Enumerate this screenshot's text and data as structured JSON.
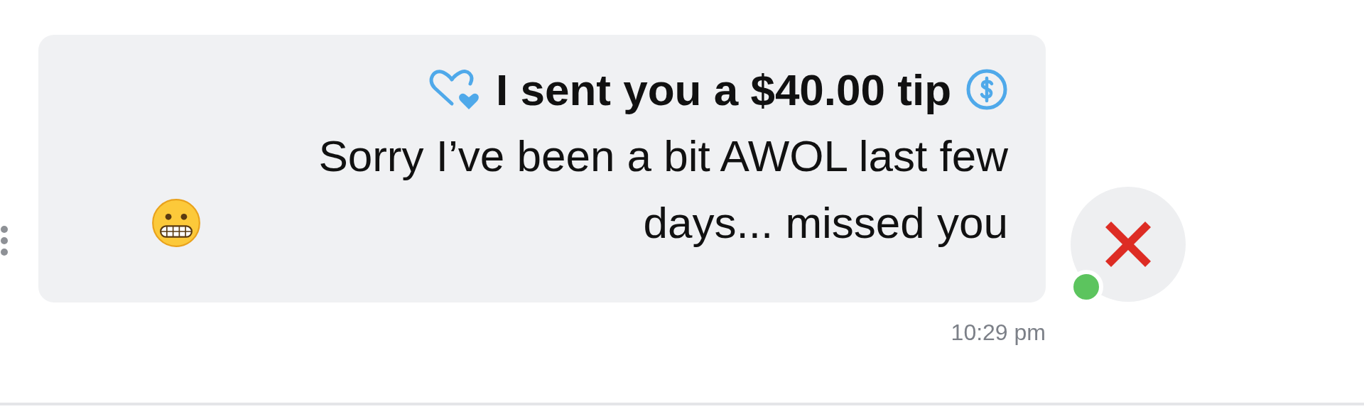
{
  "avatar": {
    "online": true
  },
  "message": {
    "tip_text": "I sent you a $40.00 tip",
    "body": "Sorry I’ve been a bit AWOL last few days... missed you",
    "time": "10:29 pm"
  }
}
